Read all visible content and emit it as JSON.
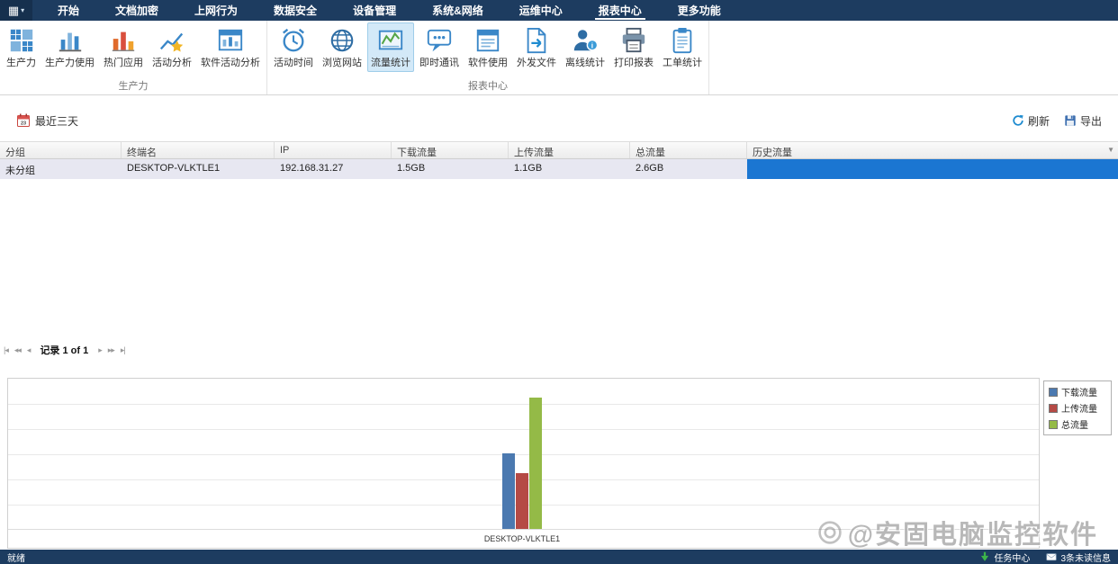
{
  "topbar": {
    "menu_items": [
      {
        "label": "开始",
        "active": false
      },
      {
        "label": "文档加密",
        "active": false
      },
      {
        "label": "上网行为",
        "active": false
      },
      {
        "label": "数据安全",
        "active": false
      },
      {
        "label": "设备管理",
        "active": false
      },
      {
        "label": "系统&网络",
        "active": false
      },
      {
        "label": "运维中心",
        "active": false
      },
      {
        "label": "报表中心",
        "active": true
      },
      {
        "label": "更多功能",
        "active": false
      }
    ]
  },
  "ribbon": {
    "groups": [
      {
        "label": "生产力",
        "buttons": [
          {
            "label": "生产力",
            "icon": "productivity-grid-icon",
            "selected": false
          },
          {
            "label": "生产力使用",
            "icon": "productivity-usage-icon",
            "selected": false
          },
          {
            "label": "热门应用",
            "icon": "hot-apps-icon",
            "selected": false
          },
          {
            "label": "活动分析",
            "icon": "activity-analysis-icon",
            "selected": false
          },
          {
            "label": "软件活动分析",
            "icon": "software-activity-icon",
            "selected": false
          }
        ]
      },
      {
        "label": "报表中心",
        "buttons": [
          {
            "label": "活动时间",
            "icon": "active-time-icon",
            "selected": false
          },
          {
            "label": "浏览网站",
            "icon": "browse-web-icon",
            "selected": false
          },
          {
            "label": "流量统计",
            "icon": "traffic-stats-icon",
            "selected": true
          },
          {
            "label": "即时通讯",
            "icon": "im-icon",
            "selected": false
          },
          {
            "label": "软件使用",
            "icon": "software-usage-icon",
            "selected": false
          },
          {
            "label": "外发文件",
            "icon": "file-out-icon",
            "selected": false
          },
          {
            "label": "离线统计",
            "icon": "offline-stats-icon",
            "selected": false
          },
          {
            "label": "打印报表",
            "icon": "print-report-icon",
            "selected": false
          },
          {
            "label": "工单统计",
            "icon": "work-order-icon",
            "selected": false
          }
        ]
      }
    ]
  },
  "toolbar": {
    "date_filter": "最近三天",
    "refresh": "刷新",
    "export": "导出"
  },
  "table": {
    "headers": [
      "分组",
      "终端名",
      "IP",
      "下载流量",
      "上传流量",
      "总流量",
      "历史流量"
    ],
    "rows": [
      {
        "cells": [
          "未分组",
          "DESKTOP-VLKTLE1",
          "192.168.31.27",
          "1.5GB",
          "1.1GB",
          "2.6GB"
        ],
        "history_percent": 100,
        "selected": true
      }
    ]
  },
  "pagination": {
    "label": "记录 1 of 1"
  },
  "chart_data": {
    "type": "bar",
    "title": "",
    "xlabel": "",
    "ylabel": "",
    "unit": "GB",
    "categories": [
      "DESKTOP-VLKTLE1"
    ],
    "series": [
      {
        "name": "下载流量",
        "values": [
          1.5
        ],
        "color": "#4b79b0"
      },
      {
        "name": "上传流量",
        "values": [
          1.1
        ],
        "color": "#b54a45"
      },
      {
        "name": "总流量",
        "values": [
          2.6
        ],
        "color": "#94ba47"
      }
    ],
    "ylim": [
      0,
      3
    ],
    "grid": true,
    "legend_position": "top-right"
  },
  "watermark": {
    "text": "@安固电脑监控软件"
  },
  "statusbar": {
    "ready": "就绪",
    "task_center": "任务中心",
    "unread": "3条未读信息"
  },
  "colors": {
    "topbar_bg": "#1d3c60",
    "ribbon_selected_bg": "#d3e9f8",
    "history_bar": "#1b76d2",
    "selected_row_bg": "#e7e7f1"
  }
}
